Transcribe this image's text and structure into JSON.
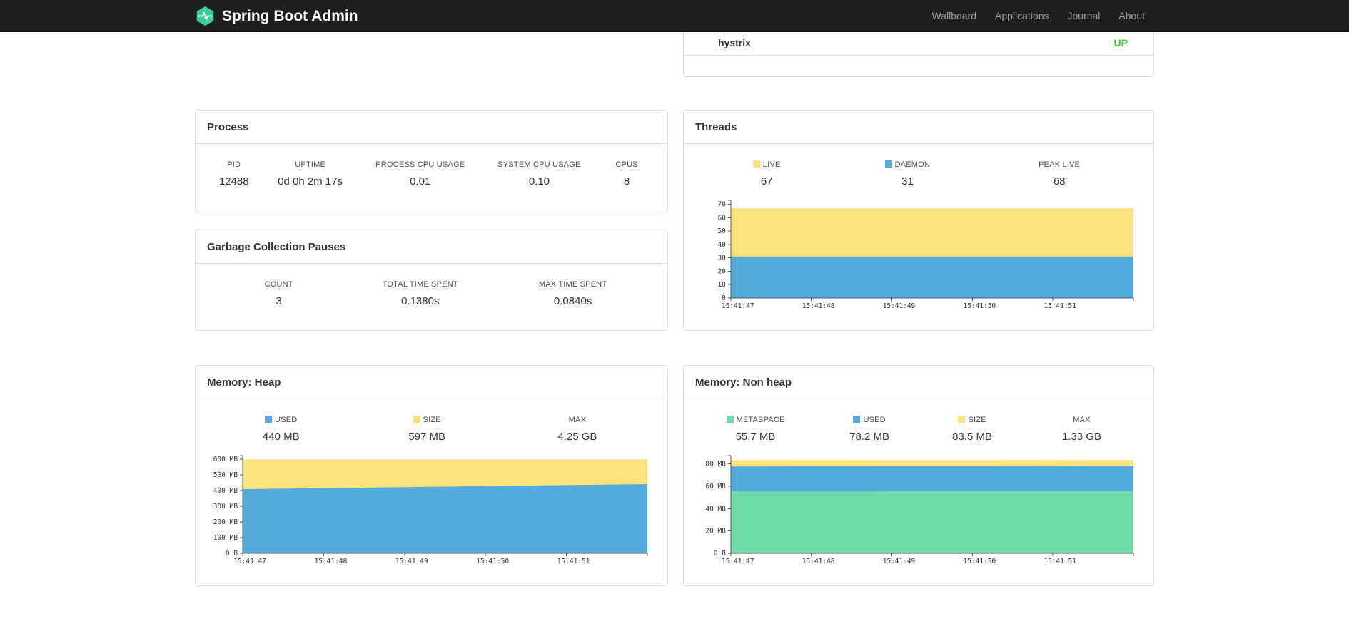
{
  "navbar": {
    "brand": "Spring Boot Admin",
    "links": [
      {
        "label": "Wallboard"
      },
      {
        "label": "Applications"
      },
      {
        "label": "Journal"
      },
      {
        "label": "About"
      }
    ]
  },
  "colors": {
    "up_status": "#3dc53d",
    "chart_blue": "#55aadd",
    "chart_yellow": "#fae27d",
    "chart_green": "#6fd9a7",
    "brand_green": "#3bcf9e",
    "navbar_bg": "#1f1f1f"
  },
  "health_panel": {
    "service": "hystrix",
    "status": "UP",
    "status_color": "#3dc53d"
  },
  "process": {
    "title": "Process",
    "columns": [
      {
        "header": "PID",
        "value": "12488"
      },
      {
        "header": "UPTIME",
        "value": "0d 0h 2m 17s"
      },
      {
        "header": "PROCESS CPU USAGE",
        "value": "0.01"
      },
      {
        "header": "SYSTEM CPU USAGE",
        "value": "0.10"
      },
      {
        "header": "CPUS",
        "value": "8"
      }
    ]
  },
  "gc": {
    "title": "Garbage Collection Pauses",
    "columns": [
      {
        "header": "COUNT",
        "value": "3"
      },
      {
        "header": "TOTAL TIME SPENT",
        "value": "0.1380s"
      },
      {
        "header": "MAX TIME SPENT",
        "value": "0.0840s"
      }
    ]
  },
  "threads": {
    "title": "Threads",
    "legend": [
      {
        "label": "LIVE",
        "value": "67",
        "color": "#fae27d"
      },
      {
        "label": "DAEMON",
        "value": "31",
        "color": "#55aadd"
      },
      {
        "label": "PEAK LIVE",
        "value": "68",
        "color": null
      }
    ]
  },
  "memory_heap": {
    "title": "Memory: Heap",
    "legend": [
      {
        "label": "USED",
        "value": "440 MB",
        "color": "#55aadd"
      },
      {
        "label": "SIZE",
        "value": "597 MB",
        "color": "#fae27d"
      },
      {
        "label": "MAX",
        "value": "4.25 GB",
        "color": null
      }
    ]
  },
  "memory_non_heap": {
    "title": "Memory: Non heap",
    "legend": [
      {
        "label": "METASPACE",
        "value": "55.7 MB",
        "color": "#6fd9a7"
      },
      {
        "label": "USED",
        "value": "78.2 MB",
        "color": "#55aadd"
      },
      {
        "label": "SIZE",
        "value": "83.5 MB",
        "color": "#fae27d"
      },
      {
        "label": "MAX",
        "value": "1.33 GB",
        "color": null
      }
    ]
  },
  "chart_data": [
    {
      "id": "threads",
      "type": "area",
      "title": "Threads",
      "x_labels": [
        "15:41:47",
        "15:41:48",
        "15:41:49",
        "15:41:50",
        "15:41:51"
      ],
      "ylim": [
        0,
        73
      ],
      "y_ticks": [
        {
          "v": 0,
          "label": "0"
        },
        {
          "v": 10,
          "label": "10"
        },
        {
          "v": 20,
          "label": "20"
        },
        {
          "v": 30,
          "label": "30"
        },
        {
          "v": 40,
          "label": "40"
        },
        {
          "v": 50,
          "label": "50"
        },
        {
          "v": 60,
          "label": "60"
        },
        {
          "v": 70,
          "label": "70"
        }
      ],
      "series": [
        {
          "name": "LIVE",
          "color": "#fae27d",
          "values": [
            67,
            67,
            67,
            67,
            67,
            67
          ]
        },
        {
          "name": "DAEMON",
          "color": "#55aadd",
          "values": [
            31,
            31,
            31,
            31,
            31,
            31
          ]
        }
      ]
    },
    {
      "id": "memory-heap",
      "type": "area",
      "title": "Memory: Heap",
      "x_labels": [
        "15:41:47",
        "15:41:48",
        "15:41:49",
        "15:41:50",
        "15:41:51"
      ],
      "ylim": [
        0,
        622
      ],
      "y_ticks": [
        {
          "v": 0,
          "label": "0 B"
        },
        {
          "v": 100,
          "label": "100 MB"
        },
        {
          "v": 200,
          "label": "200 MB"
        },
        {
          "v": 300,
          "label": "300 MB"
        },
        {
          "v": 400,
          "label": "400 MB"
        },
        {
          "v": 500,
          "label": "500 MB"
        },
        {
          "v": 600,
          "label": "600 MB"
        }
      ],
      "series": [
        {
          "name": "SIZE",
          "color": "#fae27d",
          "values": [
            597,
            597,
            597,
            597,
            597,
            597
          ]
        },
        {
          "name": "USED",
          "color": "#55aadd",
          "values": [
            408,
            415,
            421,
            428,
            434,
            440
          ]
        }
      ]
    },
    {
      "id": "memory-non-heap",
      "type": "area",
      "title": "Memory: Non heap",
      "x_labels": [
        "15:41:47",
        "15:41:48",
        "15:41:49",
        "15:41:50",
        "15:41:51"
      ],
      "ylim": [
        0,
        87.5
      ],
      "y_ticks": [
        {
          "v": 0,
          "label": "0 B"
        },
        {
          "v": 20,
          "label": "20 MB"
        },
        {
          "v": 40,
          "label": "40 MB"
        },
        {
          "v": 60,
          "label": "60 MB"
        },
        {
          "v": 80,
          "label": "80 MB"
        }
      ],
      "series": [
        {
          "name": "SIZE",
          "color": "#fae27d",
          "values": [
            83.4,
            83.4,
            83.5,
            83.5,
            83.5,
            83.5
          ]
        },
        {
          "name": "USED",
          "color": "#55aadd",
          "values": [
            77.8,
            77.9,
            78.0,
            78.0,
            78.1,
            78.2
          ]
        },
        {
          "name": "METASPACE",
          "color": "#6fd9a7",
          "values": [
            55.5,
            55.5,
            55.6,
            55.6,
            55.7,
            55.7
          ]
        }
      ]
    }
  ]
}
